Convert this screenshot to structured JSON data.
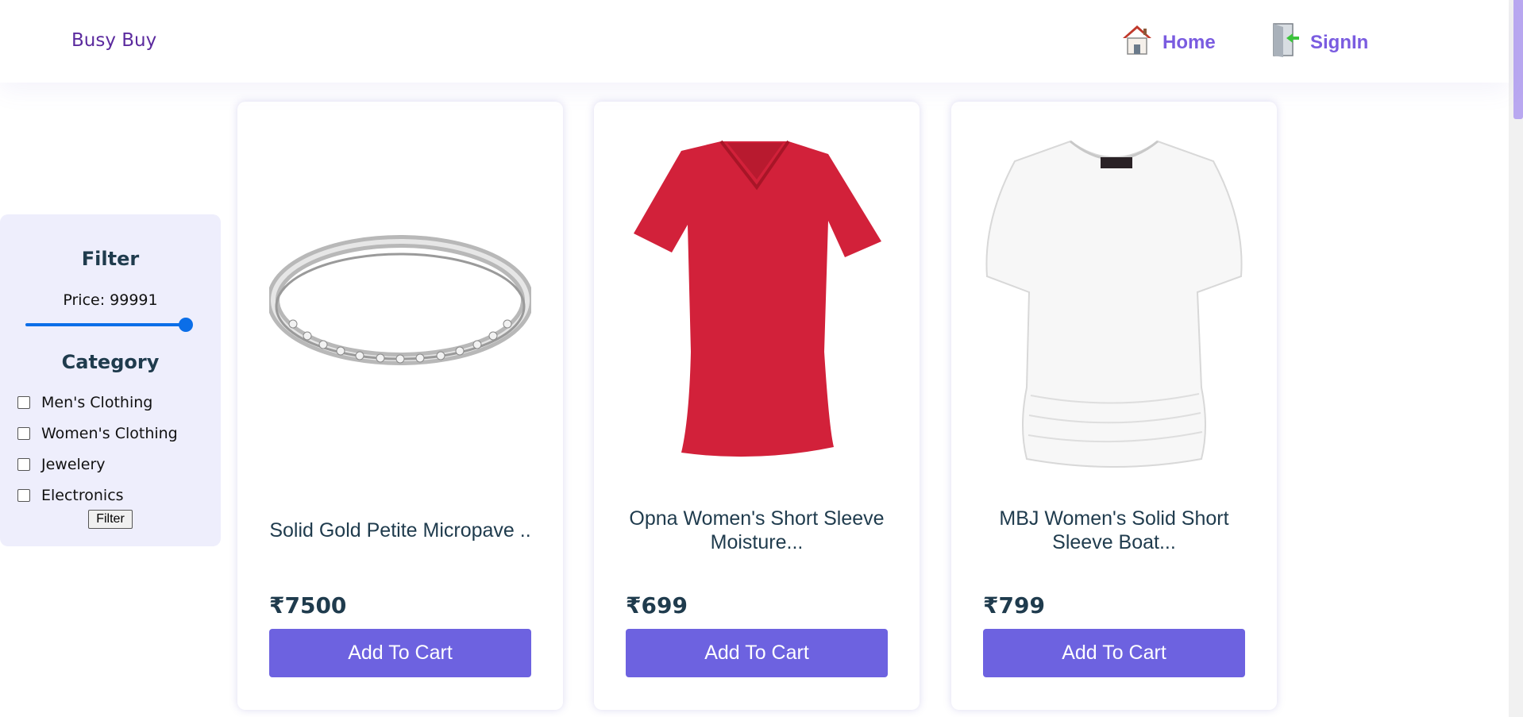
{
  "navbar": {
    "brand": "Busy Buy",
    "links": [
      {
        "label": "Home",
        "icon": "house-icon"
      },
      {
        "label": "SignIn",
        "icon": "door-enter-icon"
      }
    ],
    "link_color": "#7a5ce0"
  },
  "filter": {
    "title": "Filter",
    "price_label": "Price: 99991",
    "price_value": 99991,
    "category_title": "Category",
    "categories": [
      {
        "label": "Men's Clothing",
        "checked": false
      },
      {
        "label": "Women's Clothing",
        "checked": false
      },
      {
        "label": "Jewelery",
        "checked": false
      },
      {
        "label": "Electronics",
        "checked": false
      }
    ],
    "button_label": "Filter"
  },
  "products": [
    {
      "title": "Solid Gold Petite Micropave ..",
      "price": "₹7500",
      "button": "Add To Cart",
      "image": "silver-ring-image"
    },
    {
      "title": "Opna Women's Short Sleeve Moisture...",
      "price": "₹699",
      "button": "Add To Cart",
      "image": "red-tshirt-image"
    },
    {
      "title": "MBJ Women's Solid Short Sleeve Boat...",
      "price": "₹799",
      "button": "Add To Cart",
      "image": "white-top-image"
    }
  ],
  "colors": {
    "accent": "#6d62e0",
    "panel": "#eeeefc",
    "text": "#1f3b4d"
  }
}
